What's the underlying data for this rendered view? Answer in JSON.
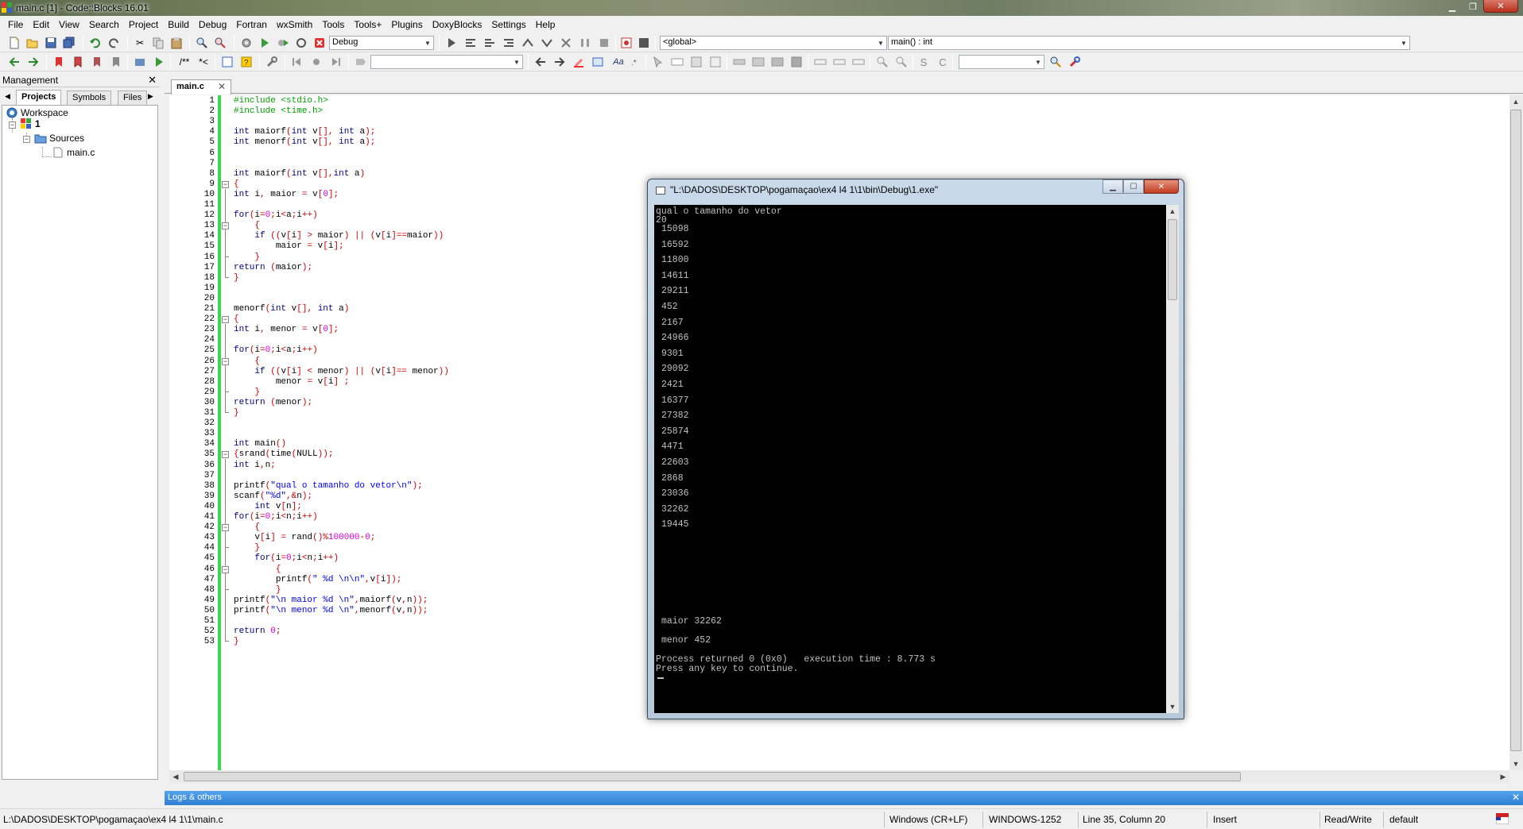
{
  "window": {
    "title": "main.c [1] - Code::Blocks 16.01"
  },
  "menu": [
    "File",
    "Edit",
    "View",
    "Search",
    "Project",
    "Build",
    "Debug",
    "Fortran",
    "wxSmith",
    "Tools",
    "Tools+",
    "Plugins",
    "DoxyBlocks",
    "Settings",
    "Help"
  ],
  "toolbar": {
    "build_target": "Debug",
    "scope": "<global>",
    "function": "main() : int",
    "doxy_comment_1": "/**",
    "doxy_comment_2": "*<"
  },
  "management": {
    "title": "Management",
    "tabs": [
      "Projects",
      "Symbols",
      "Files"
    ],
    "tree": {
      "workspace": "Workspace",
      "project": "1",
      "folder": "Sources",
      "file": "main.c"
    }
  },
  "editor": {
    "tab": "main.c",
    "lines": [
      "#include <stdio.h>",
      "#include <time.h>",
      "",
      "int maiorf(int v[], int a);",
      "int menorf(int v[], int a);",
      "",
      "",
      "int maiorf(int v[],int a)",
      "{",
      "int i, maior = v[0];",
      "",
      "for(i=0;i<a;i++)",
      "    {",
      "    if ((v[i] > maior) || (v[i]==maior))",
      "        maior = v[i];",
      "    }",
      "return (maior);",
      "}",
      "",
      "",
      "menorf(int v[], int a)",
      "{",
      "int i, menor = v[0];",
      "",
      "for(i=0;i<a;i++)",
      "    {",
      "    if ((v[i] < menor) || (v[i]== menor))",
      "        menor = v[i] ;",
      "    }",
      "return (menor);",
      "}",
      "",
      "",
      "int main()",
      "{srand(time(NULL));",
      "int i,n;",
      "",
      "printf(\"qual o tamanho do vetor\\n\");",
      "scanf(\"%d\",&n);",
      "    int v[n];",
      "for(i=0;i<n;i++)",
      "    {",
      "    v[i] = rand()%100000-0;",
      "    }",
      "    for(i=0;i<n;i++)",
      "        {",
      "        printf(\" %d \\n\\n\",v[i]);",
      "        }",
      "printf(\"\\n maior %d \\n\",maiorf(v,n));",
      "printf(\"\\n menor %d \\n\",menorf(v,n));",
      "",
      "return 0;",
      "}"
    ]
  },
  "console": {
    "title": "\"L:\\DADOS\\DESKTOP\\pogamaçao\\ex4 l4 1\\1\\bin\\Debug\\1.exe\"",
    "prompt": "qual o tamanho do vetor",
    "input": "20",
    "numbers": [
      "15098",
      "16592",
      "11800",
      "14611",
      "29211",
      "452",
      "2167",
      "24966",
      "9301",
      "29092",
      "2421",
      "16377",
      "27382",
      "25874",
      "4471",
      "22603",
      "2868",
      "23036",
      "32262",
      "19445"
    ],
    "maior": "maior 32262",
    "menor": "menor 452",
    "process": "Process returned 0 (0x0)   execution time : 8.773 s",
    "press": "Press any key to continue."
  },
  "logs": {
    "title": "Logs & others"
  },
  "status": {
    "path": "L:\\DADOS\\DESKTOP\\pogamaçao\\ex4 l4 1\\1\\main.c",
    "eol": "Windows (CR+LF)",
    "encoding": "WINDOWS-1252",
    "position": "Line 35, Column 20",
    "mode": "Insert",
    "access": "Read/Write",
    "profile": "default"
  }
}
